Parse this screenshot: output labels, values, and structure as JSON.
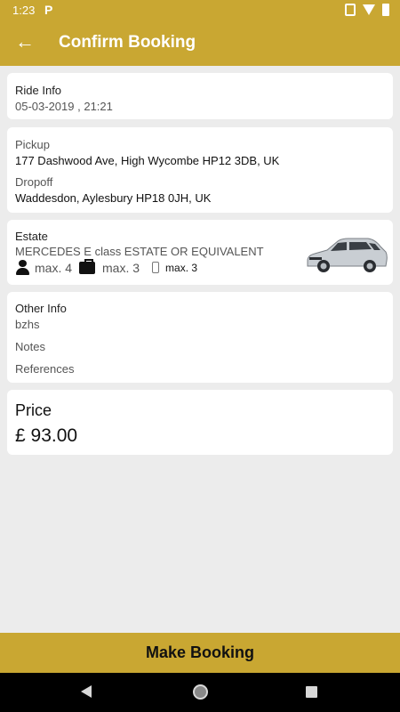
{
  "status_bar": {
    "time": "1:23",
    "app_indicator": "P"
  },
  "app_bar": {
    "title": "Confirm Booking",
    "back_icon": "arrow-left-icon"
  },
  "ride_info": {
    "label": "Ride Info",
    "datetime": "05-03-2019 , 21:21"
  },
  "route": {
    "pickup_label": "Pickup",
    "pickup_address": "177 Dashwood Ave, High Wycombe HP12 3DB, UK",
    "dropoff_label": "Dropoff",
    "dropoff_address": "Waddesdon, Aylesbury HP18 0JH, UK"
  },
  "vehicle": {
    "type": "Estate",
    "model": "MERCEDES E class ESTATE OR EQUIVALENT",
    "passengers": "max. 4",
    "suitcases": "max. 3",
    "hand_luggage": "max. 3",
    "image": "car-icon"
  },
  "other_info": {
    "label": "Other Info",
    "value": "bzhs",
    "notes_label": "Notes",
    "references_label": "References"
  },
  "price": {
    "label": "Price",
    "value": "£ 93.00"
  },
  "action": {
    "book_label": "Make Booking"
  },
  "colors": {
    "accent": "#c9a732",
    "background": "#ececec",
    "card": "#ffffff"
  }
}
